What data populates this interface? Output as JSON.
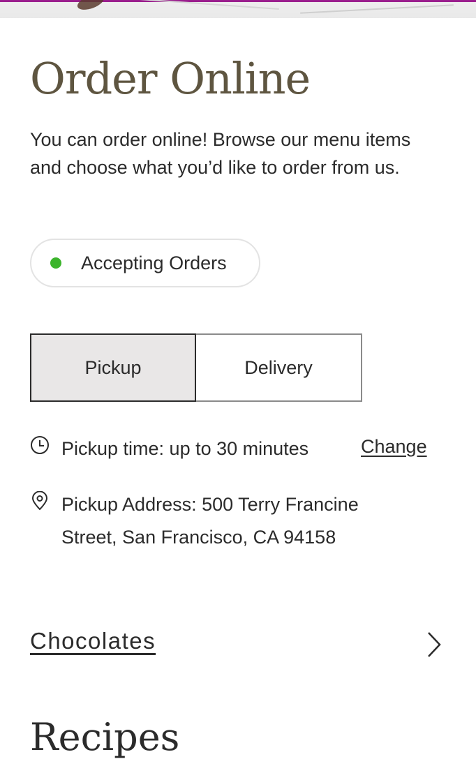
{
  "header": {
    "title": "Order Online",
    "intro": "You can order online! Browse our menu items and choose what you’d like to order from us."
  },
  "status": {
    "label": "Accepting Orders",
    "dot_color": "#3cb42c"
  },
  "fulfillment": {
    "tabs": [
      {
        "label": "Pickup",
        "selected": true
      },
      {
        "label": "Delivery",
        "selected": false
      }
    ]
  },
  "pickup": {
    "time_icon": "clock-icon",
    "time_text": "Pickup time: up to 30 minutes",
    "change_label": "Change",
    "address_icon": "map-pin-icon",
    "address_text": "Pickup Address: 500 Terry Francine Street, San Francisco, CA 94158"
  },
  "menu": {
    "category_label": "Chocolates",
    "chevron_icon": "chevron-right-icon"
  },
  "next_section": {
    "title": "Recipes"
  }
}
